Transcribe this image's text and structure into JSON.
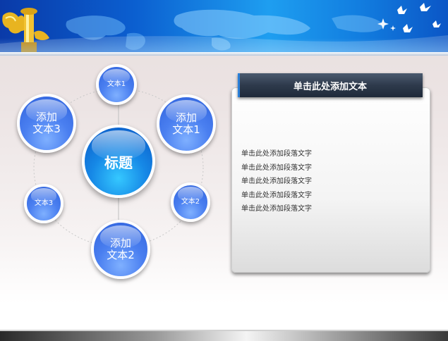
{
  "diagram": {
    "center": {
      "label": "标题"
    },
    "nodes": [
      {
        "id": "top",
        "text": "文本1"
      },
      {
        "id": "upper-right",
        "lines": [
          "添加",
          "文本1"
        ]
      },
      {
        "id": "right",
        "text": "文本2"
      },
      {
        "id": "bottom",
        "lines": [
          "添加",
          "文本2"
        ]
      },
      {
        "id": "left",
        "text": "文本3"
      },
      {
        "id": "upper-left",
        "lines": [
          "添加",
          "文本3"
        ]
      }
    ]
  },
  "panel": {
    "header": "单击此处添加文本",
    "paragraphs": [
      "单击此处添加段落文字",
      "单击此处添加段落文字",
      "单击此处添加段落文字",
      "单击此处添加段落文字",
      "单击此处添加段落文字"
    ]
  },
  "colors": {
    "banner": "#1e9ef0",
    "node": "#4a7ff0",
    "center": "#1688e6",
    "header": "#2e3a4c"
  },
  "decorations": [
    "tiananmen-huabiao-icon",
    "world-map",
    "doves",
    "stars"
  ]
}
